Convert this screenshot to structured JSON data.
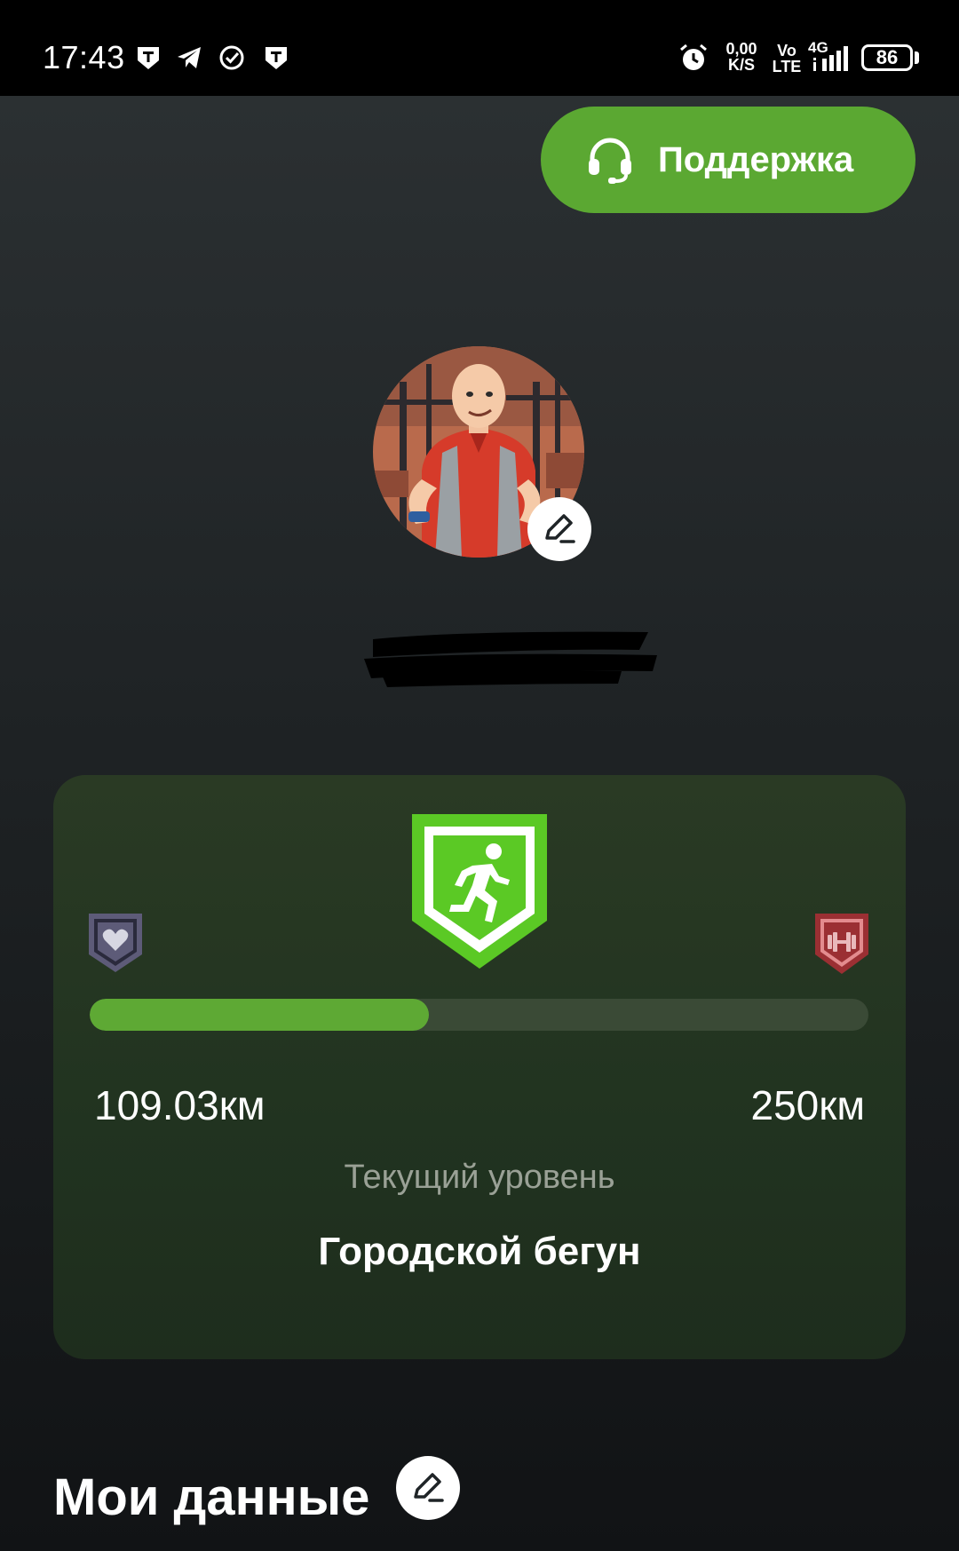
{
  "status_bar": {
    "time": "17:43",
    "net_speed_value": "0,00",
    "net_speed_unit": "K/S",
    "volte_top": "Vo",
    "volte_bottom": "LTE",
    "network": "4G",
    "battery": "86",
    "icons": [
      "shield-t-icon",
      "telegram-icon",
      "check-circle-icon",
      "shield-t-icon",
      "alarm-icon",
      "signal-icon"
    ]
  },
  "header": {
    "support_label": "Поддержка",
    "support_icon": "headset-icon"
  },
  "profile": {
    "name_redacted": true
  },
  "level_card": {
    "current_distance": "109.03км",
    "target_distance": "250км",
    "progress": 0.436,
    "caption": "Текущий уровень",
    "level_name": "Городской бегун",
    "current_badge_icon": "runner-icon",
    "prev_badge_icon": "heart-icon",
    "next_badge_icon": "dumbbell-icon"
  },
  "section": {
    "title": "Мои данные"
  },
  "colors": {
    "accent": "#5ba832",
    "card_bg": "#213320",
    "track": "#3a4a36"
  }
}
